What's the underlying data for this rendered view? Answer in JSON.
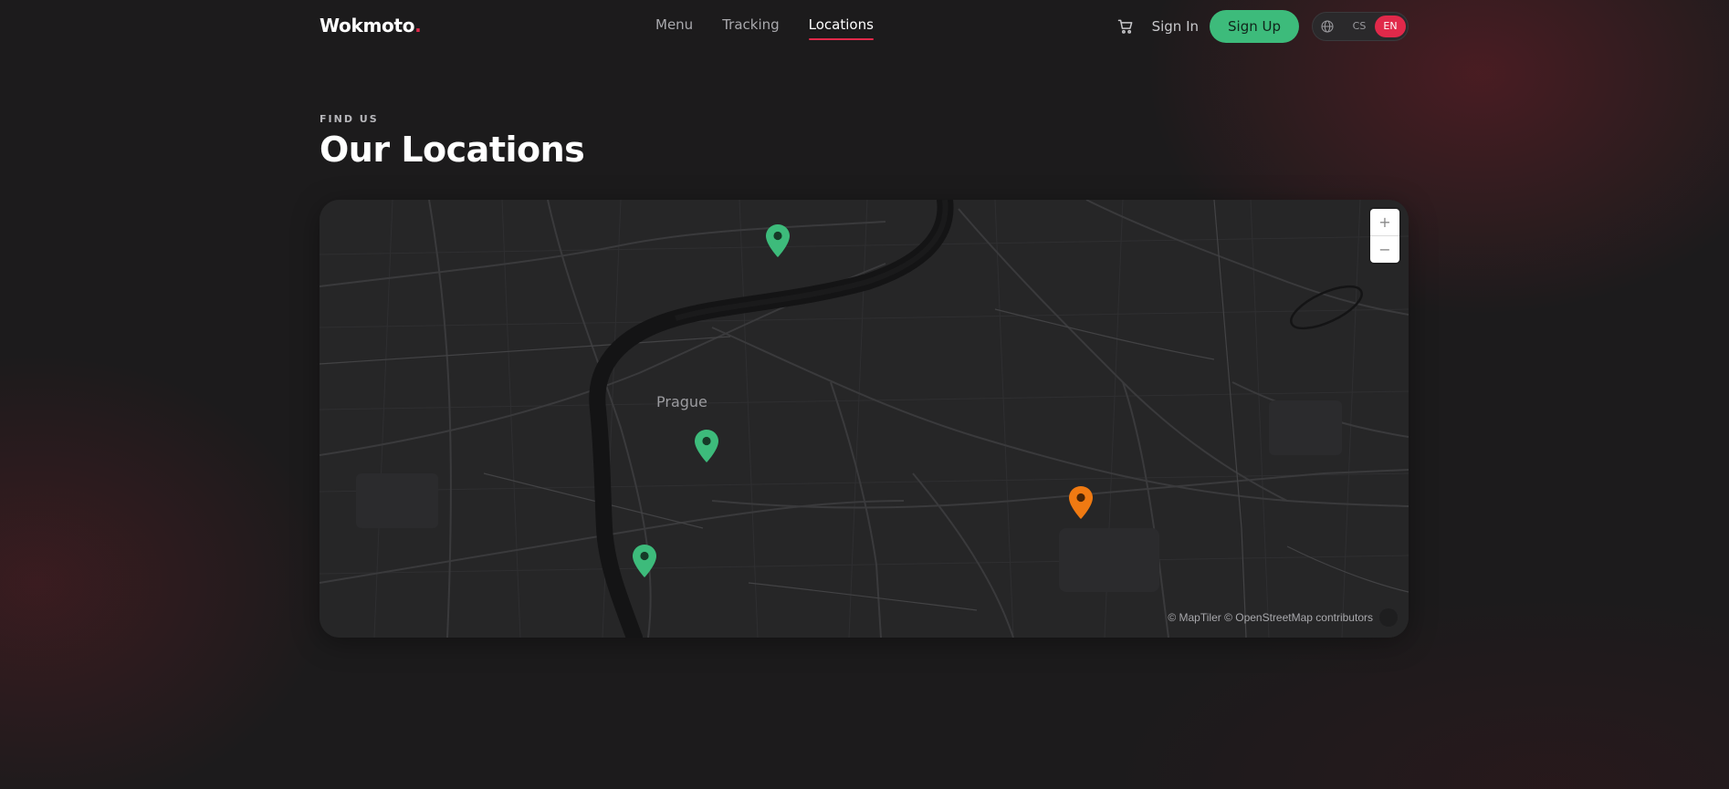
{
  "brand": {
    "name": "Wokmoto",
    "dot": "."
  },
  "nav": {
    "items": [
      {
        "label": "Menu"
      },
      {
        "label": "Tracking"
      },
      {
        "label": "Locations"
      }
    ],
    "active": "Locations"
  },
  "header": {
    "signin_label": "Sign In",
    "signup_label": "Sign Up",
    "languages": [
      "CS",
      "EN"
    ],
    "active_language": "EN"
  },
  "section": {
    "eyebrow": "FIND US",
    "title": "Our Locations"
  },
  "map": {
    "city_label": "Prague",
    "attribution": "© MapTiler © OpenStreetMap contributors",
    "zoom_in_label": "+",
    "zoom_out_label": "−",
    "pins": [
      {
        "name": "location-pin-north",
        "status": "open"
      },
      {
        "name": "location-pin-center",
        "status": "open"
      },
      {
        "name": "location-pin-south",
        "status": "open"
      },
      {
        "name": "location-pin-east",
        "status": "highlighted"
      }
    ]
  },
  "colors": {
    "accent": "#e0294a",
    "primary_button": "#3dbb7b",
    "pin_open": "#3dbb7b",
    "pin_highlighted": "#f07a12",
    "background": "#1c1b1c",
    "map_background": "#262627"
  },
  "icons": {
    "cart": "cart-icon",
    "language": "globe-icon",
    "pin": "map-pin-icon"
  }
}
